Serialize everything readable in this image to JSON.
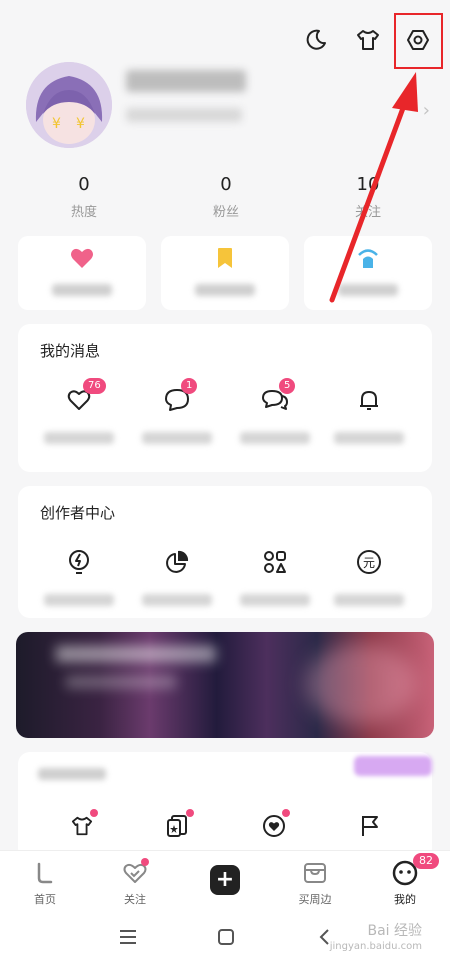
{
  "header": {
    "icons": [
      "moon-icon",
      "tshirt-icon",
      "settings-icon"
    ]
  },
  "stats": [
    {
      "value": "0",
      "label": "热度"
    },
    {
      "value": "0",
      "label": "粉丝"
    },
    {
      "value": "10",
      "label": "关注"
    }
  ],
  "messages": {
    "title": "我的消息",
    "items": [
      {
        "icon": "heart-outline-icon",
        "badge": "76"
      },
      {
        "icon": "comment-icon",
        "badge": "1"
      },
      {
        "icon": "chat-icon",
        "badge": "5"
      },
      {
        "icon": "bell-icon",
        "badge": ""
      }
    ]
  },
  "creator": {
    "title": "创作者中心",
    "items": [
      {
        "icon": "bulb-icon"
      },
      {
        "icon": "pie-chart-icon"
      },
      {
        "icon": "shapes-icon"
      },
      {
        "icon": "yuan-icon",
        "glyph": "元"
      }
    ]
  },
  "tabbar": {
    "tabs": [
      {
        "label": "首页"
      },
      {
        "label": "关注"
      },
      {
        "label": ""
      },
      {
        "label": "买周边"
      },
      {
        "label": "我的",
        "badge": "82"
      }
    ]
  },
  "watermark": {
    "line1": "Bai 经验",
    "line2": "jingyan.baidu.com"
  },
  "colors": {
    "accent": "#f04a7e",
    "highlight": "#e8262a"
  }
}
